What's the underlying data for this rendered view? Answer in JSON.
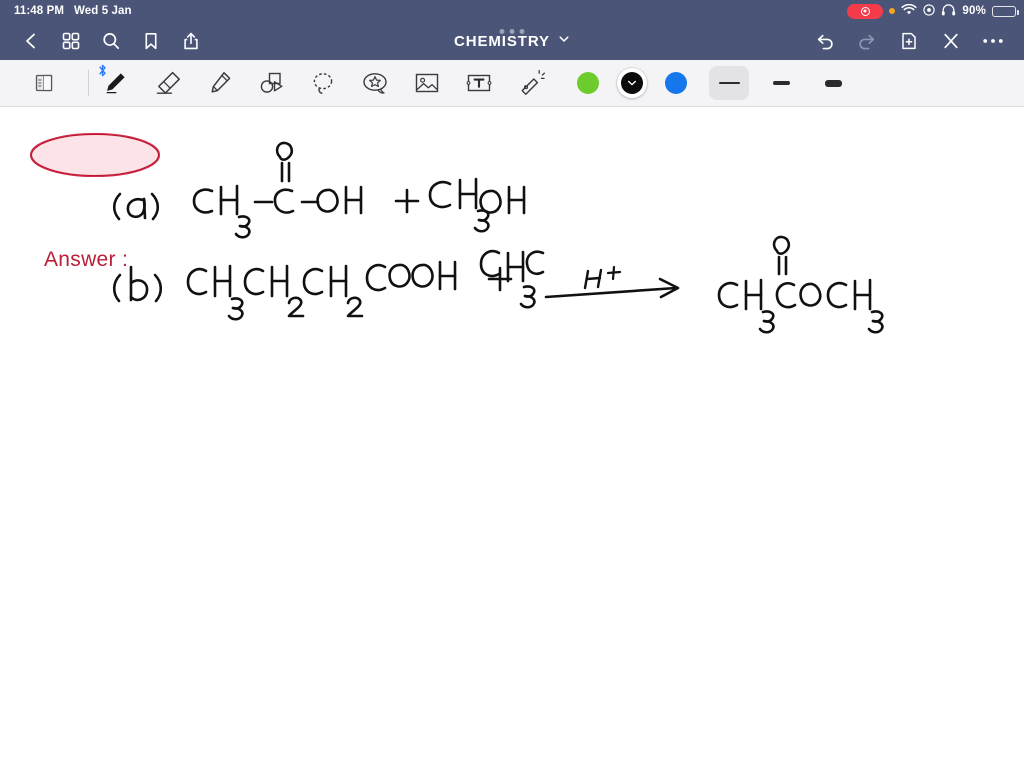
{
  "status_bar": {
    "time": "11:48 PM",
    "date": "Wed 5 Jan",
    "battery_percent": "90%",
    "icons": [
      "screen-recording-indicator",
      "orange-privacy-dot",
      "wifi-icon",
      "control-center-icon",
      "headphones-icon",
      "battery-icon"
    ]
  },
  "nav_bar": {
    "title": "CHEMISTRY",
    "left_icons": [
      {
        "name": "back-chevron-icon",
        "label": "Back"
      },
      {
        "name": "grid-view-icon",
        "label": "Library"
      },
      {
        "name": "search-icon",
        "label": "Search"
      },
      {
        "name": "bookmark-icon",
        "label": "Bookmark"
      },
      {
        "name": "share-icon",
        "label": "Share"
      }
    ],
    "right_icons": [
      {
        "name": "undo-icon",
        "label": "Undo"
      },
      {
        "name": "redo-icon",
        "label": "Redo"
      },
      {
        "name": "add-page-icon",
        "label": "New Page"
      },
      {
        "name": "close-icon",
        "label": "Close"
      },
      {
        "name": "more-icon",
        "label": "More"
      }
    ]
  },
  "toolbar": {
    "page_flip": {
      "name": "page-flip-icon",
      "label": "Page View"
    },
    "tools": [
      {
        "name": "pen-tool",
        "label": "Pen",
        "selected": true,
        "bluetooth": true,
        "bluetooth_glyph": "ᛗ"
      },
      {
        "name": "eraser-tool",
        "label": "Eraser",
        "selected": false
      },
      {
        "name": "highlighter-tool",
        "label": "Highlighter",
        "selected": false
      },
      {
        "name": "shapes-tool",
        "label": "Shapes",
        "selected": false
      },
      {
        "name": "lasso-select-tool",
        "label": "Lasso Select",
        "selected": false
      },
      {
        "name": "sticker-tool",
        "label": "Stickers",
        "selected": false
      },
      {
        "name": "image-tool",
        "label": "Image",
        "selected": false
      },
      {
        "name": "text-box-tool",
        "label": "Text Box",
        "selected": false
      },
      {
        "name": "laser-pointer-tool",
        "label": "Laser Pointer",
        "selected": false
      }
    ],
    "colors": [
      {
        "name": "color-swatch-green",
        "hex": "#6ECB2E",
        "selected": false
      },
      {
        "name": "color-swatch-black",
        "hex": "#0B0B0B",
        "selected": true
      },
      {
        "name": "color-swatch-blue",
        "hex": "#1577EB",
        "selected": false
      }
    ],
    "stroke_widths": [
      {
        "name": "stroke-width-thin",
        "label": "Thin",
        "selected": true
      },
      {
        "name": "stroke-width-medium",
        "label": "Medium",
        "selected": false
      },
      {
        "name": "stroke-width-thick",
        "label": "Thick",
        "selected": false
      }
    ]
  },
  "canvas": {
    "answer_label": "Answer :",
    "answer_label_color": "#B8203A",
    "answer_highlight_fill": "#FBE3E7",
    "ink_color": "#111111",
    "notes": [
      {
        "name": "equation-line-a",
        "part_label": "(a)",
        "reactant_1": "CH3 - C(=O) - OH",
        "plus": "+",
        "reactant_2": "CH3OH",
        "arrow_label": "H+",
        "product": "CH3 C(=O) O CH3"
      },
      {
        "name": "equation-line-b",
        "part_label": "(b)",
        "reactant_1": "CH3CH2CH2COOH",
        "plus": "+",
        "reactant_2": "CH3C"
      }
    ]
  }
}
